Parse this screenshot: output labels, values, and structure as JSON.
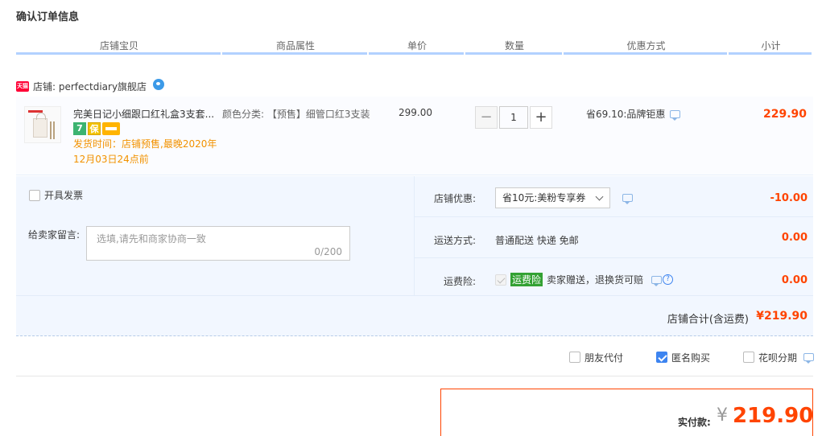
{
  "page": {
    "title": "确认订单信息"
  },
  "columns": [
    "店铺宝贝",
    "商品属性",
    "单价",
    "数量",
    "优惠方式",
    "小计"
  ],
  "shop": {
    "badge": "天猫",
    "label": "店铺: perfectdiary旗舰店"
  },
  "item": {
    "title": "完美日记小细跟口红礼盒3支套...",
    "badges": [
      "7",
      "保"
    ],
    "ship_note": "发货时间：店铺预售,最晚2020年12月03日24点前",
    "attr_label": "颜色分类:",
    "attr_value": "【预售】细管口红3支装",
    "unit_price": "299.00",
    "quantity": "1",
    "qty_minus": "−",
    "qty_plus": "+",
    "discount": "省69.10:品牌钜惠",
    "subtotal": "229.90"
  },
  "options": {
    "invoice_label": "开具发票",
    "message_label": "给卖家留言:",
    "message_placeholder": "选填,请先和商家协商一致",
    "message_count": "0/200",
    "shop_coupon_label": "店铺优惠:",
    "shop_coupon_value": "省10元:美粉专享券",
    "shop_coupon_amount": "-10.00",
    "shipping_label": "运送方式:",
    "shipping_value": "普通配送 快递 免邮",
    "shipping_amount": "0.00",
    "insurance_label": "运费险:",
    "insurance_tag": "运费险",
    "insurance_text": "卖家赠送，退换货可赔",
    "insurance_help": "?",
    "insurance_amount": "0.00"
  },
  "shop_total": {
    "label": "店铺合计(含运费)",
    "amount": "¥219.90"
  },
  "extras": [
    {
      "label": "朋友代付",
      "checked": false
    },
    {
      "label": "匿名购买",
      "checked": true
    },
    {
      "label": "花呗分期",
      "checked": false
    }
  ],
  "payment": {
    "label": "实付款:",
    "currency": "¥",
    "amount": "219.90"
  },
  "colors": {
    "accent": "#ff4400",
    "header_rule": "#b2d1ff",
    "option_bg": "#f2f7ff",
    "ship_note": "#f29200"
  }
}
